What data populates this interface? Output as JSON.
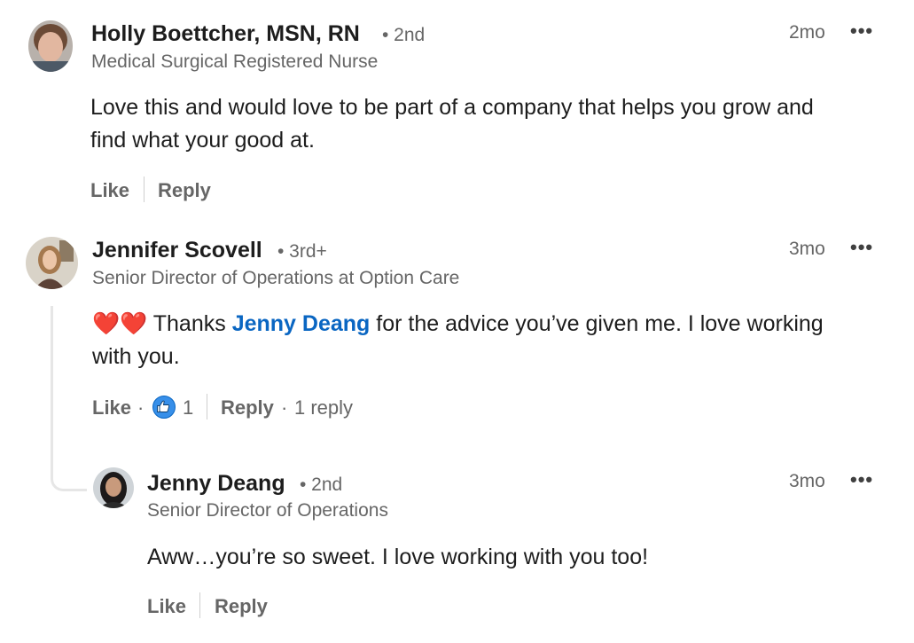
{
  "comments": [
    {
      "name": "Holly Boettcher, MSN, RN",
      "degree": "• 2nd",
      "headline": "Medical Surgical Registered Nurse",
      "time": "2mo",
      "more": "•••",
      "body_line1": "Love this and would love to be part of a company that helps you grow and",
      "body_line2": "find what your good at.",
      "actions": {
        "like": "Like",
        "reply": "Reply"
      }
    },
    {
      "name": "Jennifer Scovell",
      "degree": "• 3rd+",
      "headline": "Senior Director of Operations at Option Care",
      "time": "3mo",
      "more": "•••",
      "emoji": "❤️❤️",
      "body_pre": " Thanks ",
      "mention": "Jenny Deang",
      "body_post": " for the advice you’ve given me. I love working",
      "body_line2": "with you.",
      "actions": {
        "like": "Like",
        "dot1": "·",
        "reaction_count": "1",
        "reply": "Reply",
        "dot2": "·",
        "reply_count": "1 reply"
      }
    },
    {
      "name": "Jenny Deang",
      "degree": "• 2nd",
      "headline": "Senior Director of Operations",
      "time": "3mo",
      "more": "•••",
      "body_line1": "Aww…you’re so sweet.  I love working with you too!",
      "actions": {
        "like": "Like",
        "reply": "Reply"
      }
    }
  ],
  "colors": {
    "mention": "#0a66c2",
    "like_reaction": "#378fe9"
  }
}
